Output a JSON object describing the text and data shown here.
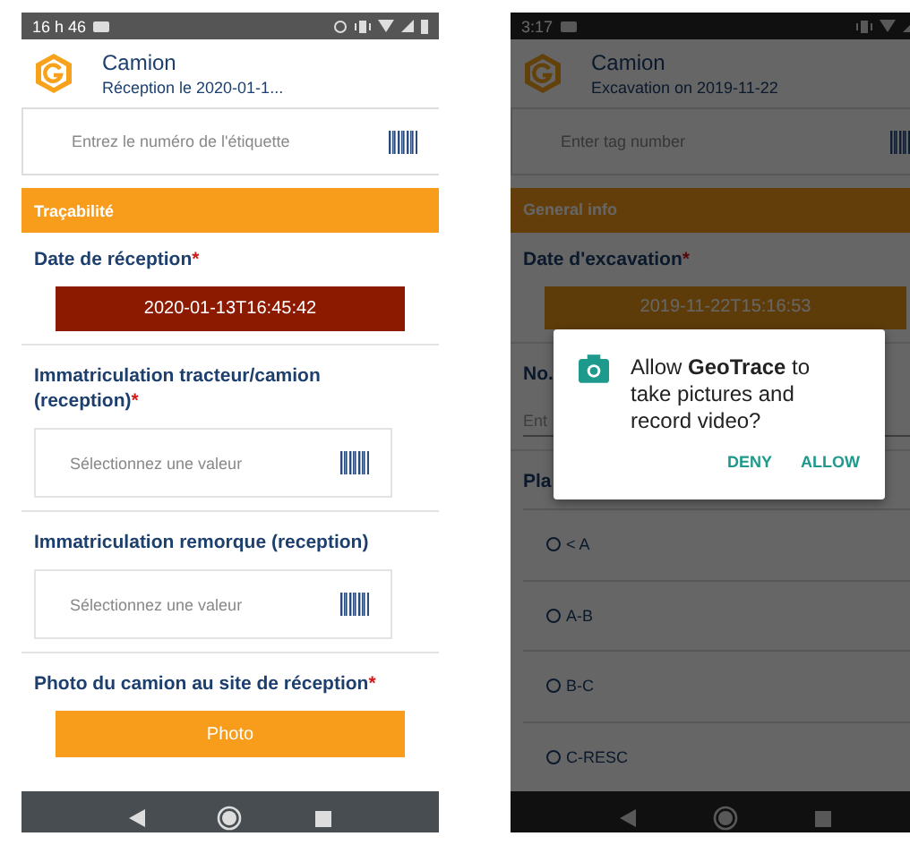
{
  "phones": [
    {
      "status_bar": {
        "time": "16 h 46"
      },
      "header": {
        "title": "Camion",
        "subtitle": "Réception le 2020-01-1..."
      },
      "tag_field": {
        "placeholder": "Entrez le numéro de l'étiquette"
      },
      "items": [
        {
          "kind": "section",
          "text": "Traçabilité"
        },
        {
          "kind": "label",
          "text": "Date de réception",
          "mark": "*"
        },
        {
          "kind": "date",
          "text": "2020-01-13T16:45:42"
        },
        {
          "kind": "label",
          "text": "Immatriculation tracteur/camion (reception)",
          "mark": "*"
        },
        {
          "kind": "scan",
          "placeholder": "Sélectionnez une valeur"
        },
        {
          "kind": "label",
          "text": "Immatriculation remorque (reception)"
        },
        {
          "kind": "scan",
          "placeholder": "Sélectionnez une valeur"
        },
        {
          "kind": "label",
          "text": "Photo du camion au site de réception",
          "mark": "*"
        },
        {
          "kind": "photo",
          "text": "Photo"
        }
      ]
    },
    {
      "status_bar": {
        "time": "3:17"
      },
      "header": {
        "title": "Camion",
        "subtitle": "Excavation on 2019-11-22"
      },
      "tag_field": {
        "placeholder": "Enter tag number"
      },
      "items": [
        {
          "kind": "section",
          "text": "General info"
        },
        {
          "kind": "label",
          "text": "Date d'excavation",
          "mark": "*"
        },
        {
          "kind": "date",
          "text": "2019-11-22T15:16:53"
        },
        {
          "kind": "label",
          "text": "No."
        },
        {
          "kind": "input",
          "placeholder": "Ent"
        },
        {
          "kind": "label",
          "text": "Pla"
        },
        {
          "kind": "radio",
          "text": "< A",
          "selected": false
        },
        {
          "kind": "radio",
          "text": "A-B",
          "selected": false
        },
        {
          "kind": "radio",
          "text": "B-C",
          "selected": false
        },
        {
          "kind": "radio",
          "text": "C-RESC",
          "selected": false
        }
      ],
      "dialog": {
        "message": "Allow **GeoTrace** to take pictures and record video?",
        "buttons": [
          "DENY",
          "ALLOW"
        ]
      }
    }
  ]
}
